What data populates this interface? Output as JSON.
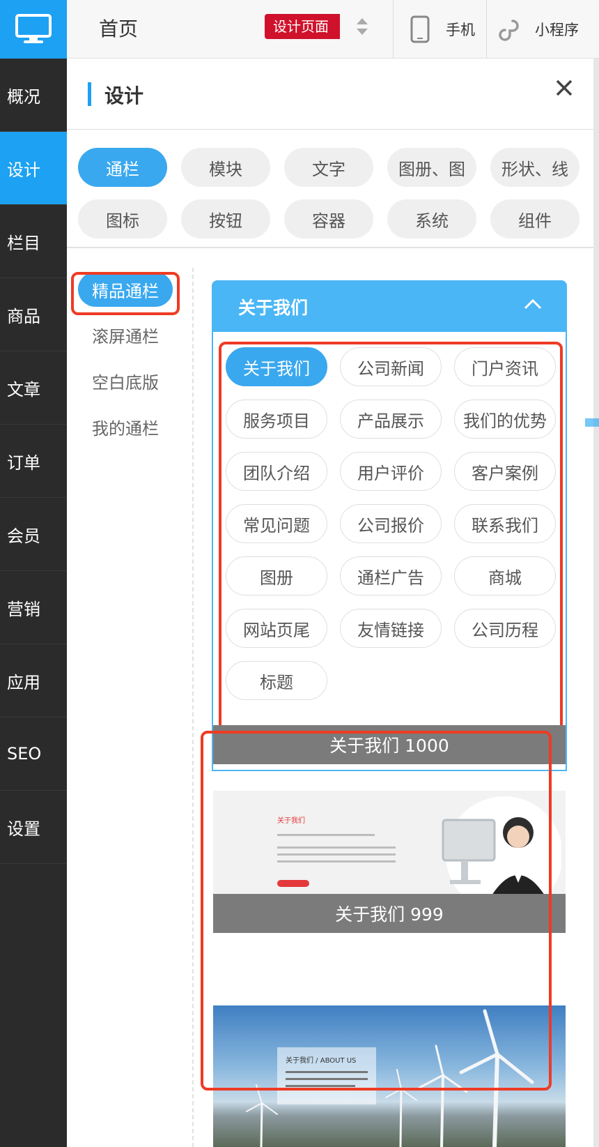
{
  "topbar": {
    "home": "首页",
    "design_badge": "设计页面",
    "phone": "手机",
    "miniapp": "小程序"
  },
  "leftnav": {
    "items": [
      {
        "label": "概况"
      },
      {
        "label": "设计",
        "active": true
      },
      {
        "label": "栏目"
      },
      {
        "label": "商品"
      },
      {
        "label": "文章"
      },
      {
        "label": "订单"
      },
      {
        "label": "会员"
      },
      {
        "label": "营销"
      },
      {
        "label": "应用"
      },
      {
        "label": "SEO"
      },
      {
        "label": "设置"
      }
    ]
  },
  "panel": {
    "title": "设计",
    "categories": [
      "通栏",
      "模块",
      "文字",
      "图册、图",
      "形状、线",
      "图标",
      "按钮",
      "容器",
      "系统",
      "组件"
    ],
    "active_category": "通栏",
    "subcategories": [
      "精品通栏",
      "滚屏通栏",
      "空白底版",
      "我的通栏"
    ],
    "active_subcategory": "精品通栏",
    "accordion": {
      "title": "关于我们",
      "tags": [
        "关于我们",
        "公司新闻",
        "门户资讯",
        "服务项目",
        "产品展示",
        "我们的优势",
        "团队介绍",
        "用户评价",
        "客户案例",
        "常见问题",
        "公司报价",
        "联系我们",
        "图册",
        "通栏广告",
        "商城",
        "网站页尾",
        "友情链接",
        "公司历程",
        "标题"
      ],
      "active_tag": "关于我们"
    },
    "templates": [
      {
        "label": "关于我们 1000"
      },
      {
        "label": "关于我们 999"
      }
    ],
    "thumb1_title": "关于我们",
    "thumb2_title": "关于我们 / ABOUT US"
  },
  "colors": {
    "accent": "#1da1f2",
    "pill_active": "#3aa8ee",
    "badge_red": "#d0112b",
    "highlight_red": "#ee3b24",
    "nav_bg": "#2b2b2b"
  },
  "icons": {
    "logo": "monitor-icon",
    "phone": "phone-icon",
    "miniapp": "link-icon",
    "close": "close-icon",
    "sort": "sort-icon",
    "collapse": "chevron-up-icon"
  }
}
